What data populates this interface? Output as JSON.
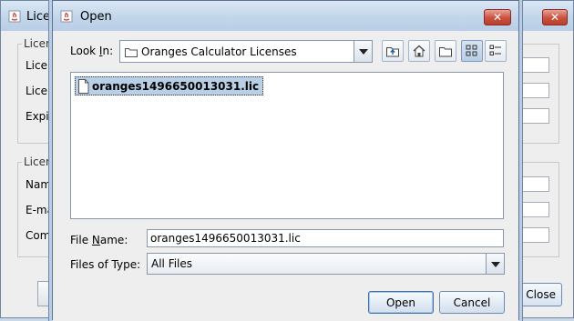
{
  "background_window": {
    "title": "License Manager",
    "group1_title": "License",
    "group1_labels": [
      "License",
      "License",
      "Expiration"
    ],
    "group2_title": "License Holder",
    "group2_labels": [
      "Name",
      "E-mail",
      "Company"
    ],
    "close_button": "Close"
  },
  "dialog": {
    "title": "Open",
    "look_in": {
      "label_before": "Look ",
      "label_mnemonic": "I",
      "label_after": "n:",
      "value": "Oranges Calculator Licenses"
    },
    "toolbar": {
      "icons": [
        "up-one-level-icon",
        "home-icon",
        "new-folder-icon",
        "list-view-icon",
        "details-view-icon"
      ]
    },
    "files": [
      {
        "name": "oranges1496650013031.lic",
        "selected": true
      }
    ],
    "file_name": {
      "label_before": "File ",
      "label_mnemonic": "N",
      "label_after": "ame:",
      "value": "oranges1496650013031.lic"
    },
    "file_type": {
      "label": "Files of Type:",
      "value": "All Files"
    },
    "buttons": {
      "open": "Open",
      "cancel": "Cancel"
    }
  },
  "colors": {
    "titlebar": "#c2d5ea",
    "close_button": "#c9513e",
    "selection": "#b8cfe5"
  }
}
